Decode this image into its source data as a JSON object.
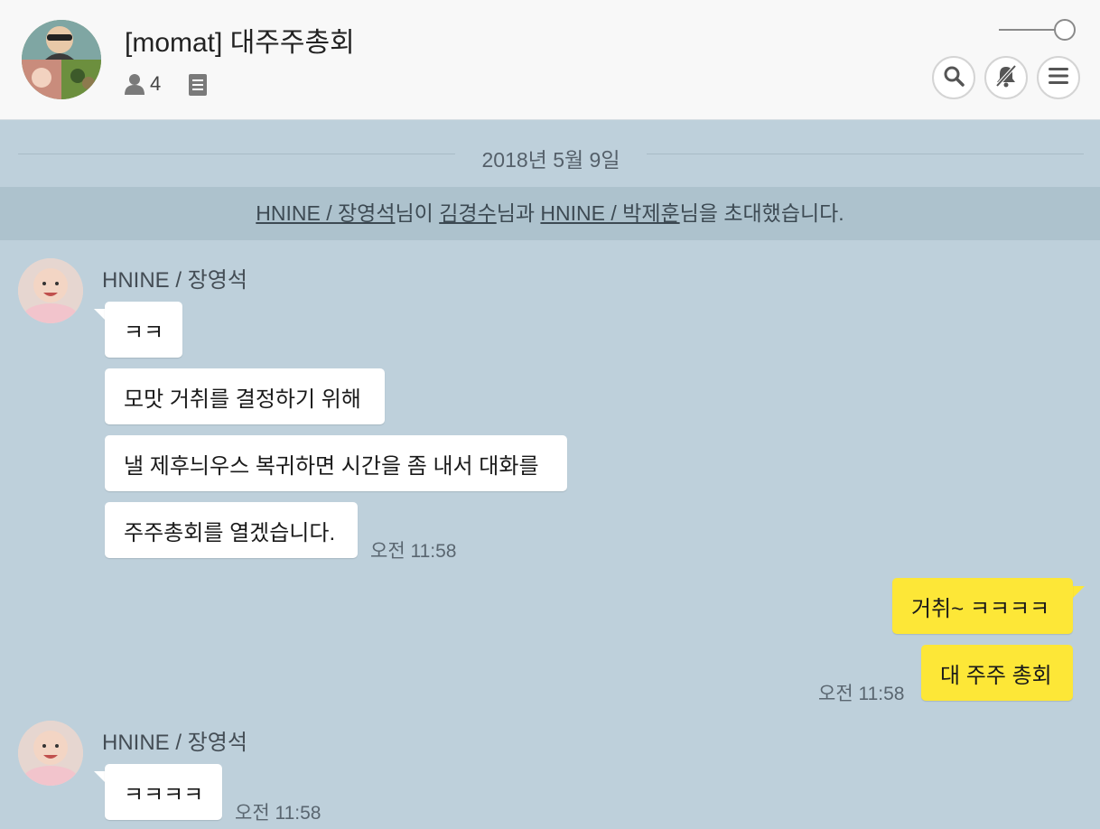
{
  "header": {
    "title": "[momat] 대주주총회",
    "member_count": "4",
    "icons": {
      "member": "person-icon",
      "notice": "notice-icon",
      "search": "search-icon",
      "mute": "bell-off-icon",
      "menu": "menu-icon"
    }
  },
  "date_divider": "2018년 5월 9일",
  "system_message": {
    "inviter": "HNINE / 장영석",
    "part1": "님이 ",
    "invitee1": "김경수",
    "part2": "님과 ",
    "invitee2": "HNINE / 박제훈",
    "part3": "님을 초대했습니다."
  },
  "messages": [
    {
      "sender": "HNINE / 장영석",
      "bubbles": [
        "ㅋㅋ",
        "모맛 거취를 결정하기 위해",
        "낼 제후늬우스 복귀하면 시간을 좀 내서 대화를",
        "주주총회를 열겠습니다."
      ],
      "time": "오전 11:58"
    },
    {
      "sender": "me",
      "bubbles": [
        "거취~ ㅋㅋㅋㅋ",
        "대 주주 총회"
      ],
      "time": "오전 11:58"
    },
    {
      "sender": "HNINE / 장영석",
      "bubbles": [
        "ㅋㅋㅋㅋ"
      ],
      "time": "오전 11:58"
    }
  ],
  "colors": {
    "chat_background": "#bed0db",
    "my_bubble": "#fde737",
    "other_bubble": "#ffffff",
    "header_background": "#f8f8f8"
  }
}
